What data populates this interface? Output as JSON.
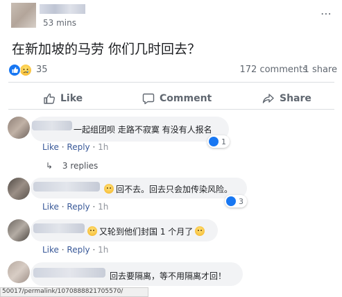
{
  "post": {
    "time": "53 mins",
    "menu_icon": "more-dots-icon",
    "text": "在新加坡的马劳 你们几时回去？",
    "reactions": {
      "count": "35",
      "types": [
        "like",
        "sad"
      ]
    },
    "comments_count": "172 comments",
    "shares_count": "1 share"
  },
  "actions": {
    "like_label": "Like",
    "comment_label": "Comment",
    "share_label": "Share"
  },
  "comments": [
    {
      "text": "一起组团呗 走路不寂寞 有没有人报名",
      "like_label": "Like",
      "reply_label": "Reply",
      "time": "1h",
      "reaction_count": "1"
    },
    {
      "text": "回不去。回去只会加传染风险。",
      "like_label": "Like",
      "reply_label": "Reply",
      "time": "1h",
      "reaction_count": "3"
    },
    {
      "text": "又轮到他们封国 1 个月了",
      "like_label": "Like",
      "reply_label": "Reply",
      "time": "1h"
    },
    {
      "text": "回去要隔离，等不用隔离才回！"
    }
  ],
  "replies_label": "3 replies",
  "status_url": "50017/permalink/1070888821705570/",
  "colors": {
    "accent": "#385898",
    "like_blue": "#1877f2",
    "bubble_bg": "#f2f3f5",
    "divider": "#dadde1"
  }
}
